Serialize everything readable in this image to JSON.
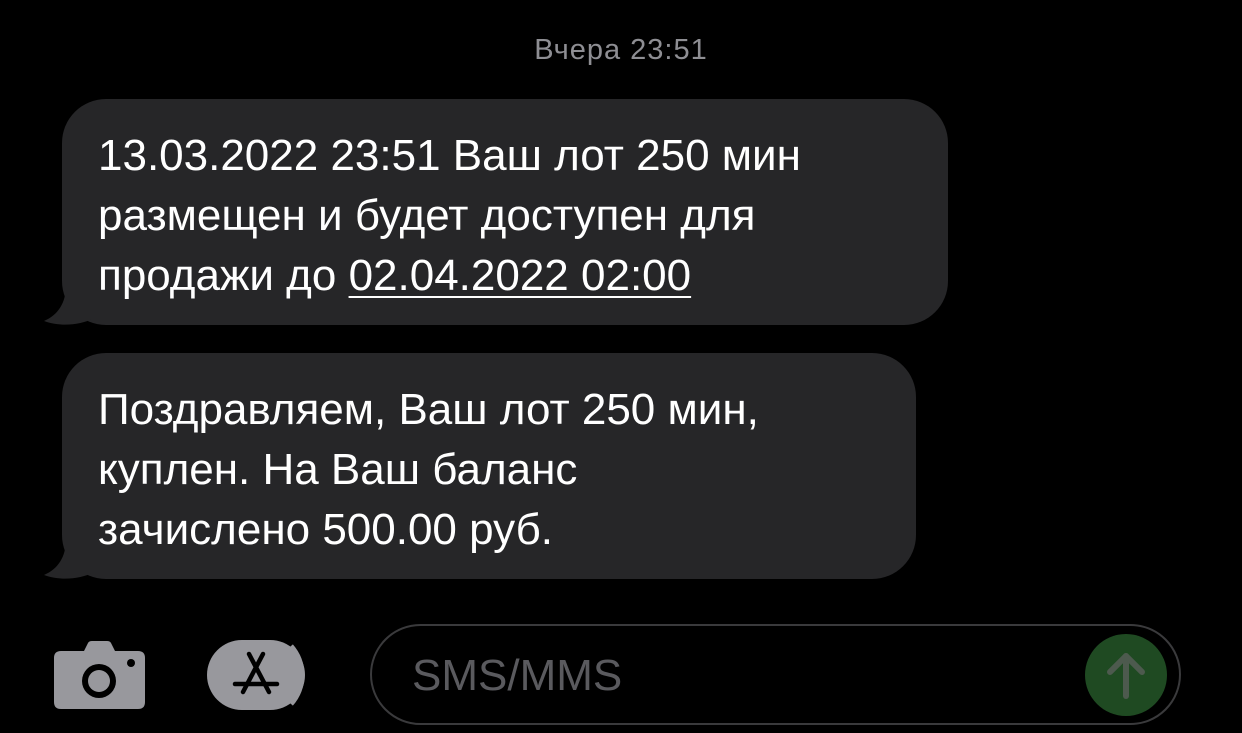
{
  "thread": {
    "timestamp": "Вчера 23:51"
  },
  "messages": [
    {
      "lines": [
        "13.03.2022 23:51 Ваш лот 250 мин",
        "размещен и будет доступен для"
      ],
      "last_line_prefix": "продажи до ",
      "last_line_link": "02.04.2022 02:00"
    },
    {
      "lines": [
        "Поздравляем, Ваш лот 250 мин,",
        "куплен. На Ваш баланс",
        "зачислено 500.00 руб."
      ]
    }
  ],
  "composer": {
    "placeholder": "SMS/MMS",
    "camera_icon": "camera-icon",
    "apps_icon": "app-store-icon",
    "send_icon": "arrow-up-icon"
  },
  "colors": {
    "background": "#000000",
    "bubble_incoming": "#262628",
    "send_button": "#1f4a22",
    "timestamp": "#8e8e93"
  }
}
